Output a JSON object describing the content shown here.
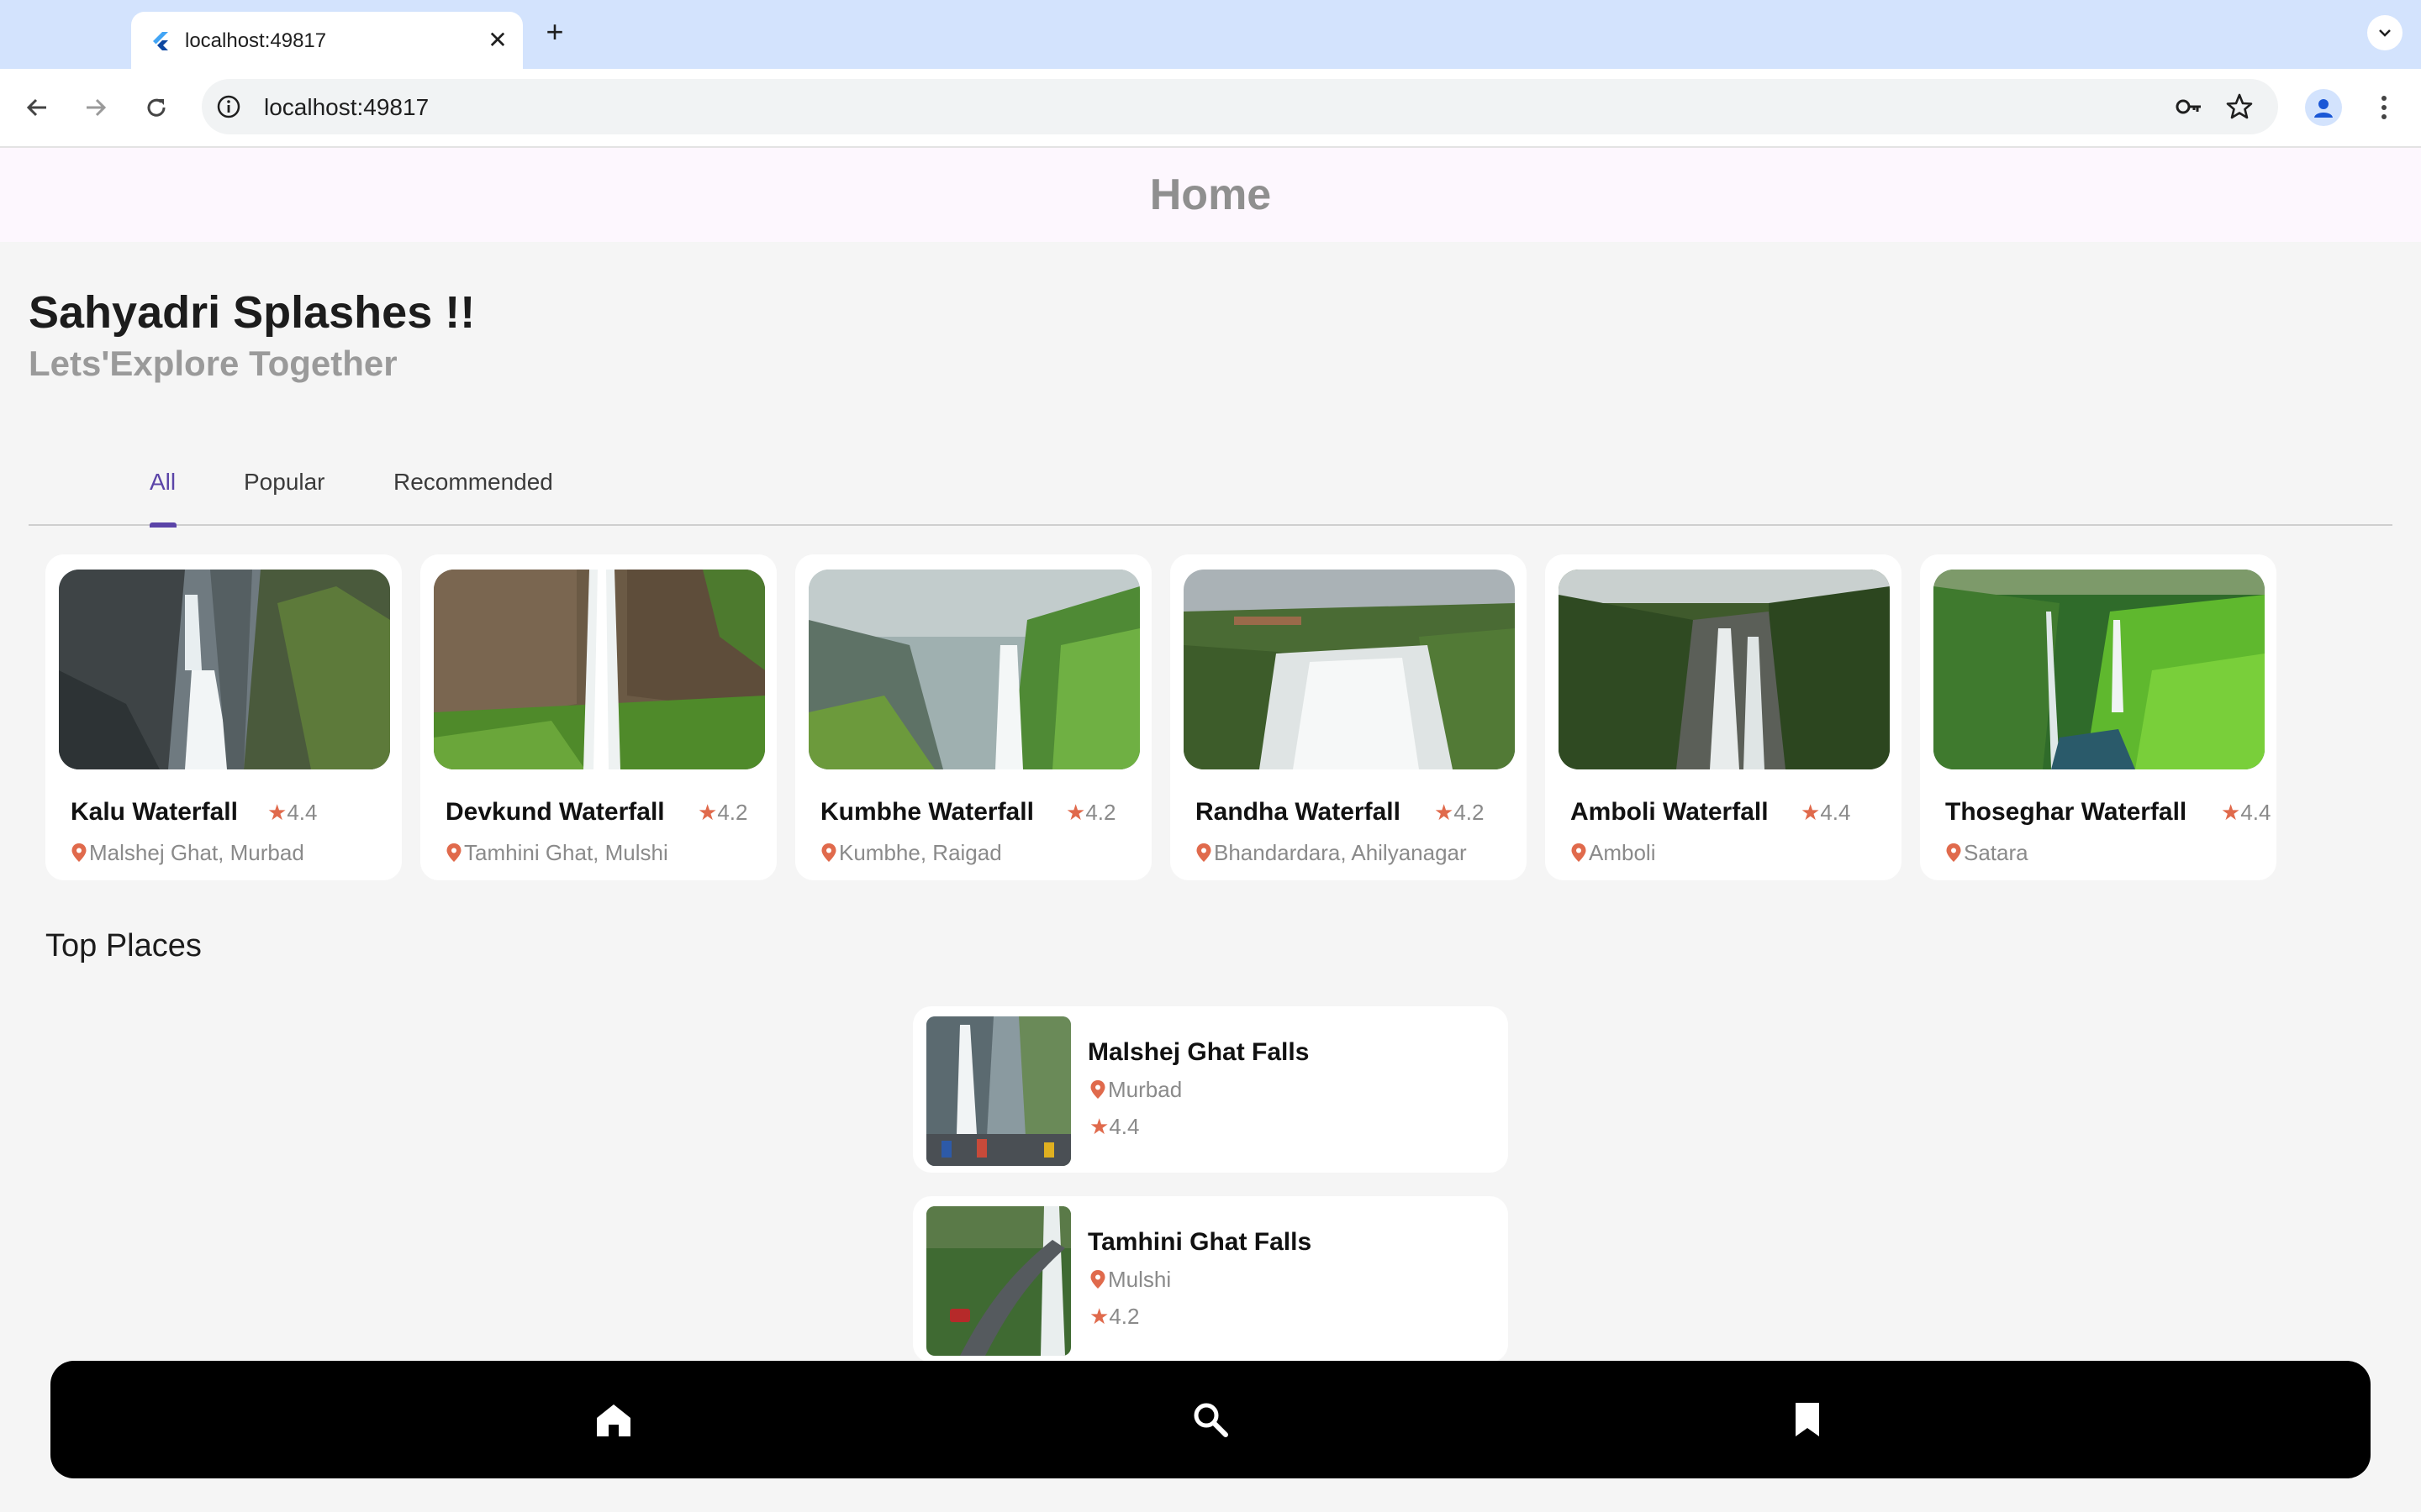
{
  "browser": {
    "tab_title": "localhost:49817",
    "new_tab_symbol": "+",
    "close_symbol": "✕",
    "url": "localhost:49817",
    "icons": [
      "flutter-favicon",
      "back-arrow-icon",
      "forward-arrow-icon",
      "reload-icon",
      "site-info-icon",
      "password-key-icon",
      "bookmark-star-icon",
      "profile-icon",
      "kebab-menu-icon",
      "tab-search-icon"
    ]
  },
  "appbar": {
    "title": "Home"
  },
  "hero": {
    "title": "Sahyadri Splashes !!",
    "subtitle": "Lets'Explore Together"
  },
  "tabs": {
    "items": [
      "All",
      "Popular",
      "Recommended"
    ],
    "active": "All",
    "accent_color": "#5b44a8"
  },
  "cards": [
    {
      "name": "Kalu Waterfall",
      "rating": "4.4",
      "location": "Malshej Ghat, Murbad"
    },
    {
      "name": "Devkund Waterfall",
      "rating": "4.2",
      "location": "Tamhini Ghat, Mulshi"
    },
    {
      "name": "Kumbhe Waterfall",
      "rating": "4.2",
      "location": "Kumbhe, Raigad"
    },
    {
      "name": "Randha Waterfall",
      "rating": "4.2",
      "location": "Bhandardara, Ahilyanagar"
    },
    {
      "name": "Amboli Waterfall",
      "rating": "4.4",
      "location": "Amboli"
    },
    {
      "name": "Thoseghar Waterfall",
      "rating": "4.4",
      "location": "Satara"
    }
  ],
  "top_places": {
    "title": "Top Places",
    "items": [
      {
        "name": "Malshej Ghat Falls",
        "location": "Murbad",
        "rating": "4.4"
      },
      {
        "name": "Tamhini Ghat Falls",
        "location": "Mulshi",
        "rating": "4.2"
      }
    ]
  },
  "bottom_nav": {
    "items": [
      "home-icon",
      "search-icon",
      "bookmark-icon"
    ]
  },
  "colors": {
    "star": "#e06a4c",
    "pin": "#e06a4c",
    "nav_background": "#000000"
  }
}
